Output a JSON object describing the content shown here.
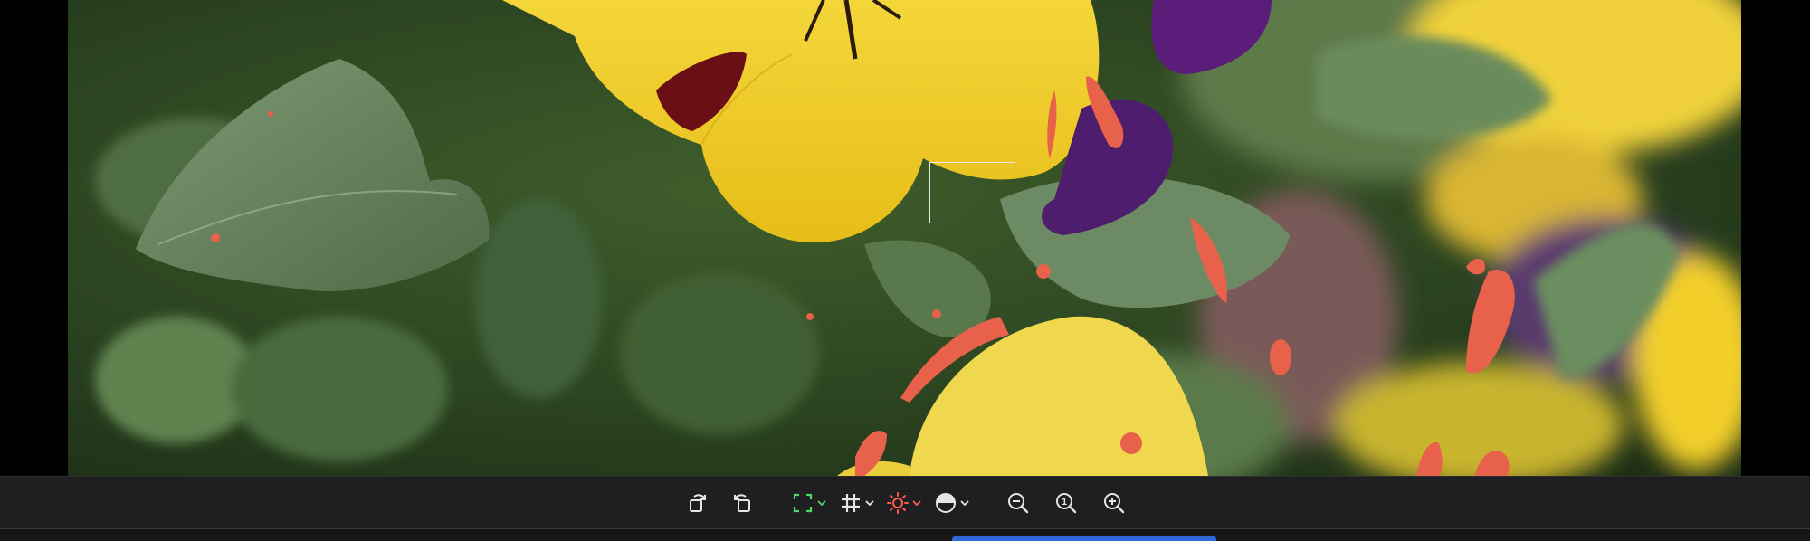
{
  "viewer": {
    "image_subject": "pansy-flowers-photo",
    "overlay_color": "#e8614a",
    "focus_box_color": "#e8e8e8"
  },
  "toolbar": {
    "background": "#1f1f21",
    "icon_color": "#e6e6e6",
    "buttons": [
      {
        "name": "rotate-right-icon"
      },
      {
        "name": "rotate-left-icon"
      },
      {
        "name": "crop-icon",
        "color": "#4cd964",
        "has_menu": true
      },
      {
        "name": "grid-icon",
        "has_menu": true
      },
      {
        "name": "exposure-icon",
        "color": "#ff5a4a",
        "has_menu": true
      },
      {
        "name": "contrast-icon",
        "has_menu": true
      },
      {
        "name": "zoom-out-icon"
      },
      {
        "name": "zoom-actual-size-icon",
        "label": "1"
      },
      {
        "name": "zoom-in-icon"
      }
    ]
  },
  "status": {
    "accent": "#2f67d8"
  }
}
